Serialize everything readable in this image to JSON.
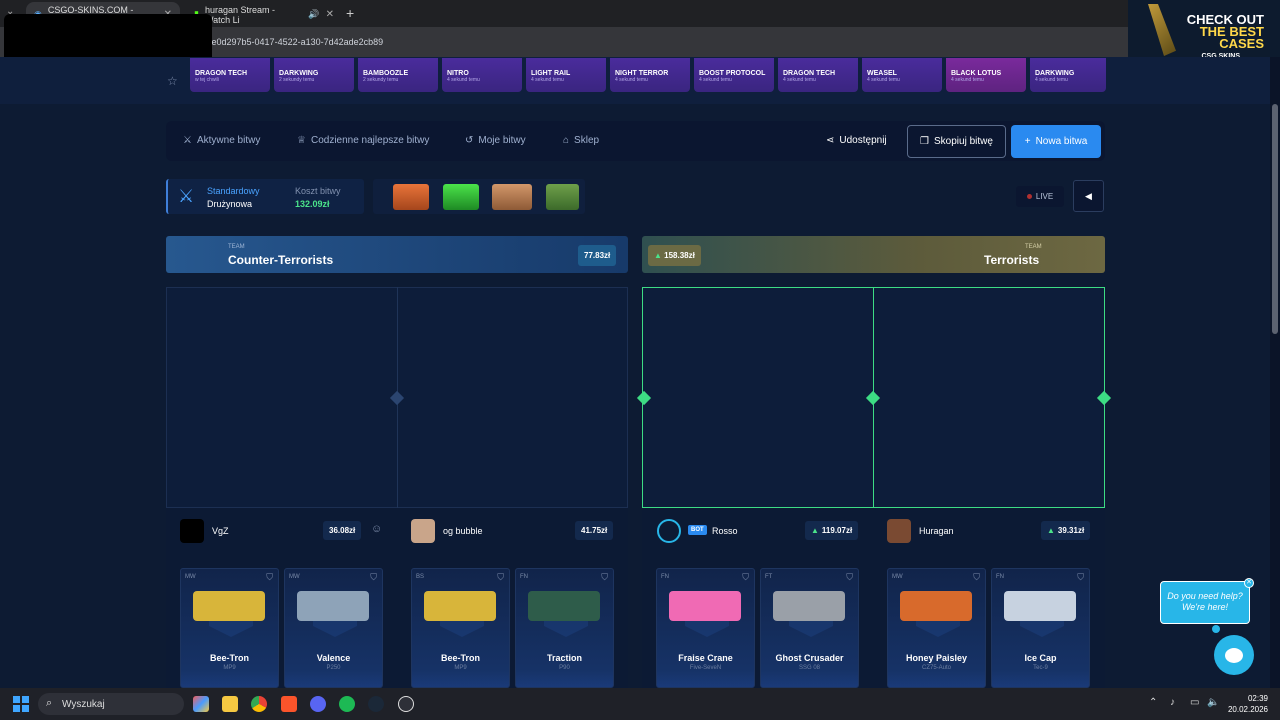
{
  "browser": {
    "tabs": [
      {
        "label": "CSGO-SKINS.COM - Najlepsze",
        "active": true
      },
      {
        "label": "huragan Stream - Watch Li",
        "active": false
      }
    ],
    "url": "e/e0d297b5-0417-4522-a130-7d42ade2cb89"
  },
  "ad": {
    "line1": "CHECK OUT",
    "line2": "THE BEST",
    "line3": "CASES",
    "brand": "CSG SKINS"
  },
  "drops": [
    {
      "name": "DRAGON TECH",
      "sub": "w tej chwili"
    },
    {
      "name": "DARKWING",
      "sub": "2 sekundy temu"
    },
    {
      "name": "BAMBOOZLE",
      "sub": "2 sekundy temu"
    },
    {
      "name": "NITRO",
      "sub": "4 sekund temu"
    },
    {
      "name": "LIGHT RAIL",
      "sub": "4 sekund temu"
    },
    {
      "name": "NIGHT TERROR",
      "sub": "4 sekund temu"
    },
    {
      "name": "BOOST PROTOCOL",
      "sub": "4 sekund temu"
    },
    {
      "name": "DRAGON TECH",
      "sub": "4 sekund temu"
    },
    {
      "name": "WEASEL",
      "sub": "4 sekund temu"
    },
    {
      "name": "BLACK LOTUS",
      "sub": "4 sekund temu"
    },
    {
      "name": "DARKWING",
      "sub": "4 sekund temu"
    }
  ],
  "nav": {
    "active_battles": "Aktywne bitwy",
    "daily_best": "Codzienne najlepsze bitwy",
    "my_battles": "Moje bitwy",
    "shop": "Sklep",
    "share": "Udostępnij",
    "copy": "Skopiuj bitwę",
    "new": "Nowa bitwa"
  },
  "battle": {
    "mode": "Standardowy",
    "type": "Drużynowa",
    "cost_label": "Koszt bitwy",
    "cost": "132.09zł",
    "live": "LIVE"
  },
  "teams": {
    "ct": {
      "label": "TEAM",
      "name": "Counter-Terrorists",
      "value": "77.83zł"
    },
    "t": {
      "label": "TEAM",
      "name": "Terrorists",
      "value": "158.38zł"
    }
  },
  "players": [
    {
      "name": "VgZ",
      "value": "36.08zł"
    },
    {
      "name": "og bubble",
      "value": "41.75zł"
    },
    {
      "name": "Rosso",
      "value": "119.07zł",
      "bot": "BOT"
    },
    {
      "name": "Huragan",
      "value": "39.31zł"
    }
  ],
  "items": [
    {
      "grade": "MW",
      "name": "Bee-Tron",
      "weapon": "MP9",
      "color": "#d8b53a"
    },
    {
      "grade": "MW",
      "name": "Valence",
      "weapon": "P250",
      "color": "#8ea3b8"
    },
    {
      "grade": "BS",
      "name": "Bee-Tron",
      "weapon": "MP9",
      "color": "#d8b53a"
    },
    {
      "grade": "FN",
      "name": "Traction",
      "weapon": "P90",
      "color": "#2e5c4a"
    },
    {
      "grade": "FN",
      "name": "Fraise Crane",
      "weapon": "Five-SeveN",
      "color": "#f06ab4"
    },
    {
      "grade": "FT",
      "name": "Ghost Crusader",
      "weapon": "SSG 08",
      "color": "#9aa0a8"
    },
    {
      "grade": "MW",
      "name": "Honey Paisley",
      "weapon": "CZ75-Auto",
      "color": "#d86a2c"
    },
    {
      "grade": "FN",
      "name": "Ice Cap",
      "weapon": "Tec-9",
      "color": "#c7d2e0"
    }
  ],
  "help": {
    "text1": "Do you need help?",
    "text2": "We're here!"
  },
  "taskbar": {
    "search": "Wyszukaj",
    "time": "02:39",
    "date": "20.02.2026"
  }
}
